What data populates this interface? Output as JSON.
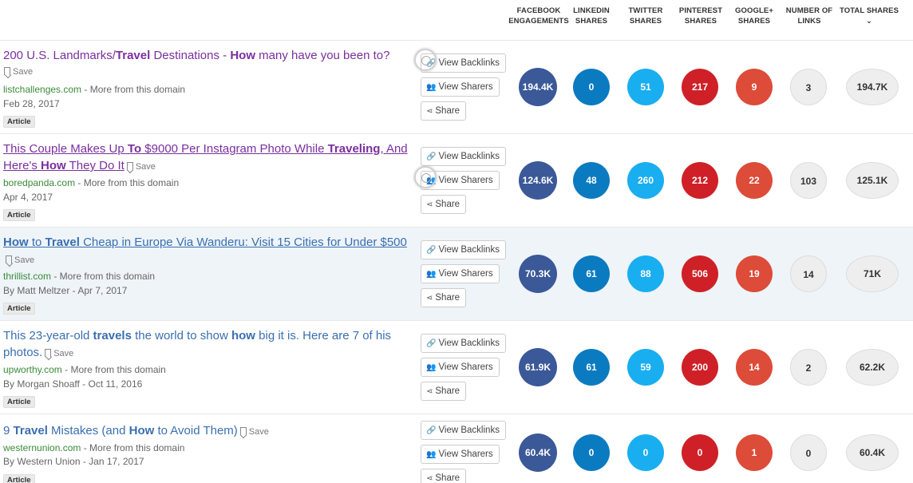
{
  "columns": {
    "facebook": "FACEBOOK\nENGAGEMENTS",
    "linkedin": "LINKEDIN\nSHARES",
    "twitter": "TWITTER\nSHARES",
    "pinterest": "PINTEREST\nSHARES",
    "googleplus": "GOOGLE+\nSHARES",
    "links": "NUMBER OF\nLINKS",
    "total": "TOTAL SHARES ⌄"
  },
  "buttons": {
    "backlinks": "View Backlinks",
    "sharers": "View Sharers",
    "share": "Share",
    "save": "Save"
  },
  "domain_suffix": " - More from this domain",
  "results": [
    {
      "title_parts": [
        "200 U.S. Landmarks/",
        "Travel",
        " Destinations - ",
        "How",
        " many have you been to?"
      ],
      "domain": "listchallenges.com",
      "date": "Feb 28, 2017",
      "type": "Article",
      "facebook": "194.4K",
      "linkedin": "0",
      "twitter": "51",
      "pinterest": "217",
      "googleplus": "9",
      "links": "3",
      "total": "194.7K"
    },
    {
      "title_parts": [
        "This Couple Makes Up ",
        "To",
        " $9000 Per Instagram Photo While ",
        "Traveling",
        ", And Here's ",
        "How",
        " They Do It"
      ],
      "domain": "boredpanda.com",
      "date": "Apr 4, 2017",
      "type": "Article",
      "facebook": "124.6K",
      "linkedin": "48",
      "twitter": "260",
      "pinterest": "212",
      "googleplus": "22",
      "links": "103",
      "total": "125.1K"
    },
    {
      "title_parts": [
        "How",
        " to ",
        "Travel",
        " Cheap in Europe Via Wanderu: Visit 15 Cities for Under $500"
      ],
      "domain": "thrillist.com",
      "date": "By Matt Meltzer - Apr 7, 2017",
      "type": "Article",
      "facebook": "70.3K",
      "linkedin": "61",
      "twitter": "88",
      "pinterest": "506",
      "googleplus": "19",
      "links": "14",
      "total": "71K"
    },
    {
      "title_parts": [
        "This 23-year-old ",
        "travels",
        " the world to show ",
        "how",
        " big it is. Here are 7 of his photos."
      ],
      "domain": "upworthy.com",
      "date": "By Morgan Shoaff - Oct 11, 2016",
      "type": "Article",
      "facebook": "61.9K",
      "linkedin": "61",
      "twitter": "59",
      "pinterest": "200",
      "googleplus": "14",
      "links": "2",
      "total": "62.2K"
    },
    {
      "title_parts": [
        "9 ",
        "Travel",
        " Mistakes (and ",
        "How",
        " to Avoid Them)"
      ],
      "domain": "westernunion.com",
      "date": "By Western Union - Jan 17, 2017",
      "type": "Article",
      "facebook": "60.4K",
      "linkedin": "0",
      "twitter": "0",
      "pinterest": "0",
      "googleplus": "1",
      "links": "0",
      "total": "60.4K"
    }
  ]
}
